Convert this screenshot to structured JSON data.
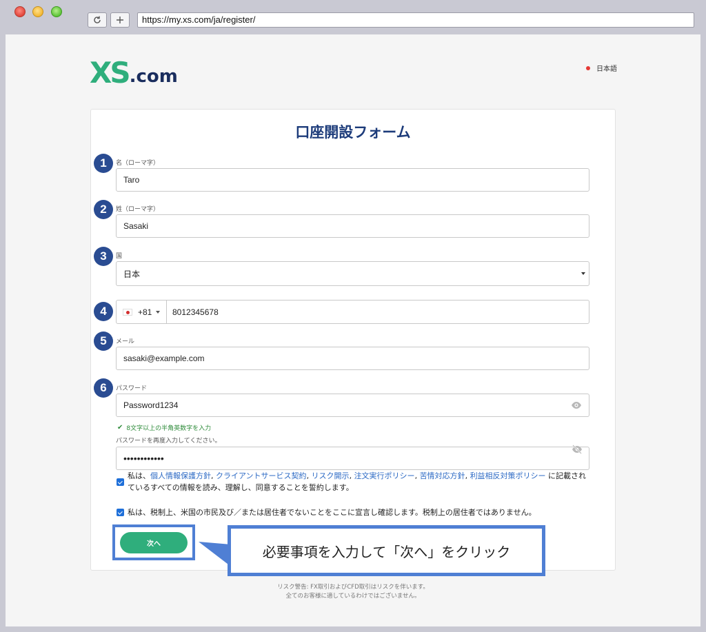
{
  "browser": {
    "url": "https://my.xs.com/ja/register/"
  },
  "header": {
    "logo_main": "XS",
    "logo_suffix": ".com",
    "language": "日本語"
  },
  "form": {
    "title": "口座開設フォーム",
    "fields": [
      {
        "badge": "1",
        "label": "名（ローマ字）",
        "value": "Taro"
      },
      {
        "badge": "2",
        "label": "姓（ローマ字）",
        "value": "Sasaki"
      },
      {
        "badge": "3",
        "label": "国",
        "value": "日本"
      },
      {
        "badge": "4",
        "label": "",
        "dial_code": "+81",
        "value": "8012345678"
      },
      {
        "badge": "5",
        "label": "メール",
        "value": "sasaki@example.com"
      },
      {
        "badge": "6",
        "label": "パスワード",
        "value": "Password1234"
      }
    ],
    "password_hint": "8文字以上の半角英数字を入力",
    "confirm_label": "パスワードを再度入力してください。",
    "confirm_value": "••••••••••••",
    "consent1": {
      "prefix": "私は、",
      "links": [
        "個人情報保護方針",
        "クライアントサービス契約",
        "リスク開示",
        "注文実行ポリシー",
        "苦情対応方針",
        "利益相反対策ポリシー"
      ],
      "sep": ", ",
      "suffix_line1": " に記載され",
      "line2": "ているすべての情報を読み、理解し、同意することを誓約します。"
    },
    "consent2": "私は、税制上、米国の市民及び／または居住者でないことをここに宣言し確認します。税制上の居住者ではありません。",
    "next_label": "次へ"
  },
  "annotation": {
    "callout": "必要事項を入力して「次へ」をクリック"
  },
  "footer": {
    "line1": "リスク警告: FX取引およびCFD取引はリスクを伴います。",
    "line2": "全てのお客様に適しているわけではございません。"
  }
}
